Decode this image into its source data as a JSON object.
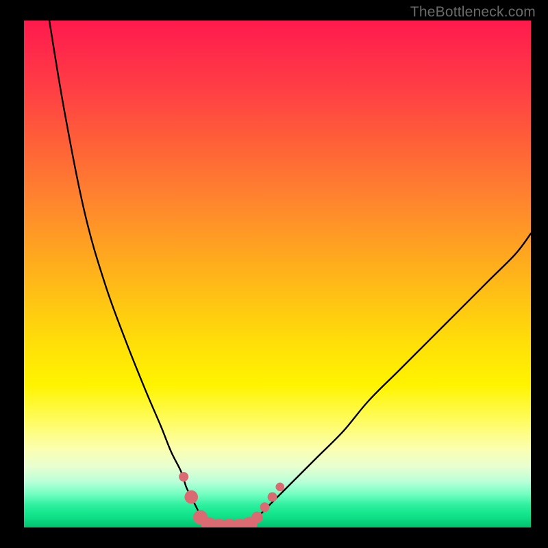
{
  "watermark": {
    "text": "TheBottleneck.com"
  },
  "colors": {
    "frame": "#000000",
    "curve": "#000000",
    "marker_fill": "#db6b72",
    "marker_stroke": "#c9555c",
    "gradient_stops": [
      "#ff1a4d",
      "#ff2a4a",
      "#ff4044",
      "#ff6038",
      "#ff8030",
      "#ffa022",
      "#ffc015",
      "#ffe008",
      "#fff400",
      "#fffc60",
      "#fbffb0",
      "#e8ffd0",
      "#b8ffd8",
      "#70ffc0",
      "#30f0a0",
      "#17e890",
      "#0edd85",
      "#08d07a",
      "#04c873",
      "#02c06c"
    ]
  },
  "chart_data": {
    "type": "line",
    "title": "",
    "xlabel": "",
    "ylabel": "",
    "xlim": [
      0,
      100
    ],
    "ylim": [
      0,
      100
    ],
    "grid": false,
    "legend": false,
    "description": "Bottleneck-style V-curve over rainbow gradient; valley ≈ x=36–44 (value≈0), left branch rises steeply to 100 at x≈5, right branch rises to ≈58 at x=100.",
    "series": [
      {
        "name": "left-branch",
        "x": [
          5,
          8,
          12,
          16,
          20,
          24,
          27,
          29,
          31,
          32,
          33,
          34,
          35,
          36
        ],
        "values": [
          100,
          82,
          62,
          48,
          37,
          27,
          20,
          15,
          11,
          8,
          6,
          4,
          2,
          0.5
        ]
      },
      {
        "name": "valley",
        "x": [
          36,
          38,
          40,
          42,
          44
        ],
        "values": [
          0.5,
          0.2,
          0.2,
          0.2,
          0.5
        ]
      },
      {
        "name": "right-branch",
        "x": [
          44,
          46,
          48,
          50,
          54,
          58,
          63,
          68,
          74,
          80,
          86,
          92,
          97,
          100
        ],
        "values": [
          0.5,
          2,
          4,
          6,
          10,
          14,
          19,
          25,
          31,
          37,
          43,
          49,
          54,
          58
        ]
      }
    ],
    "markers": {
      "name": "highlighted-points",
      "points": [
        {
          "x": 31.5,
          "y": 10,
          "r": 1.0
        },
        {
          "x": 33.0,
          "y": 6,
          "r": 1.4
        },
        {
          "x": 34.8,
          "y": 2,
          "r": 1.5
        },
        {
          "x": 36.5,
          "y": 0.5,
          "r": 1.6
        },
        {
          "x": 38.5,
          "y": 0.2,
          "r": 1.6
        },
        {
          "x": 40.5,
          "y": 0.2,
          "r": 1.6
        },
        {
          "x": 42.5,
          "y": 0.2,
          "r": 1.6
        },
        {
          "x": 44.5,
          "y": 0.6,
          "r": 1.6
        },
        {
          "x": 46.0,
          "y": 2,
          "r": 1.2
        },
        {
          "x": 47.5,
          "y": 4,
          "r": 1.0
        },
        {
          "x": 49.0,
          "y": 6,
          "r": 1.0
        },
        {
          "x": 50.5,
          "y": 8,
          "r": 0.9
        }
      ]
    }
  }
}
